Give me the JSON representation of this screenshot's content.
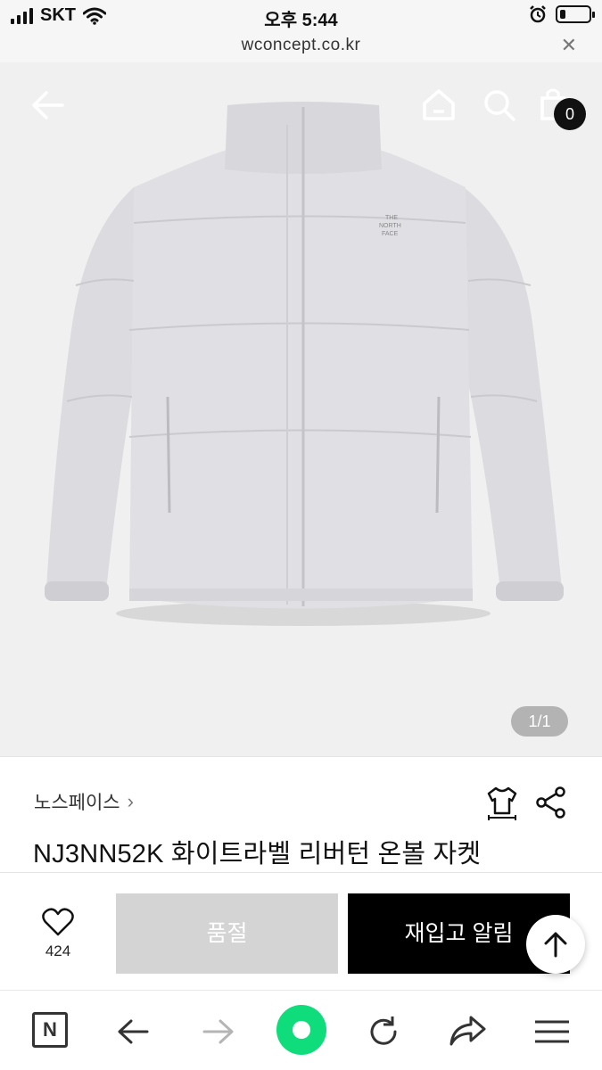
{
  "status_bar": {
    "carrier": "SKT",
    "time": "오후 5:44",
    "battery_level": 0.2
  },
  "url_bar": {
    "url": "wconcept.co.kr",
    "close_label": "✕"
  },
  "hero": {
    "page_indicator": "1/1",
    "cart_count": "0",
    "jacket_logo_lines": [
      "THE",
      "NORTH",
      "FACE"
    ]
  },
  "product": {
    "brand": "노스페이스",
    "brand_chevron": "›",
    "title": "NJ3NN52K 화이트라벨 리버턴 온볼 자켓"
  },
  "actions": {
    "like_count": "424",
    "soldout_label": "품절",
    "restock_label": "재입고 알림"
  },
  "toolbar": {
    "n_label": "N"
  },
  "colors": {
    "accent_green": "#0fdc7a",
    "soldout_gray": "#d4d4d4",
    "restock_black": "#000000"
  },
  "icons": [
    "signal-icon",
    "wifi-icon",
    "alarm-icon",
    "battery-icon",
    "back-arrow-icon",
    "home-icon",
    "search-icon",
    "shopping-bag-icon",
    "size-guide-icon",
    "share-icon",
    "heart-icon",
    "arrow-up-icon",
    "naver-n-icon",
    "arrow-left-icon",
    "arrow-right-icon",
    "reload-icon",
    "forward-share-icon",
    "menu-icon"
  ]
}
